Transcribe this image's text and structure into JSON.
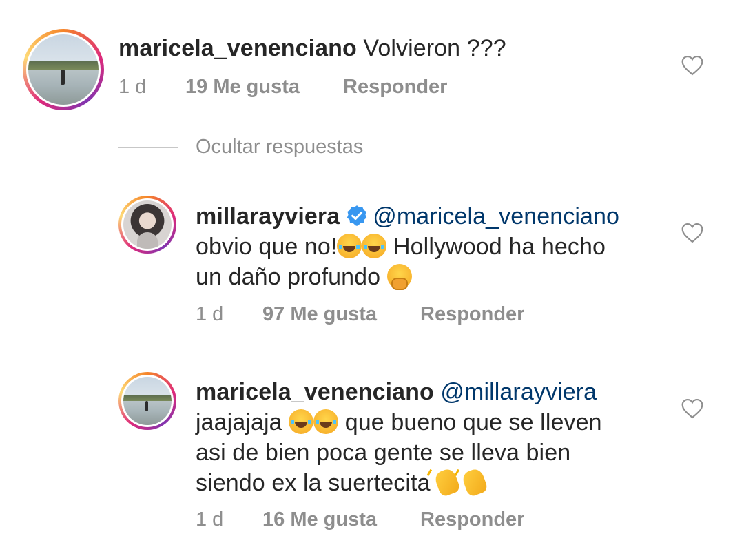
{
  "comments": [
    {
      "username": "maricela_venenciano",
      "verified": false,
      "mention": "",
      "lines": [
        "Volvieron ???"
      ],
      "time": "1 d",
      "likes": "19 Me gusta",
      "reply": "Responder",
      "avatar": "beach-photo"
    },
    {
      "username": "millarayviera",
      "verified": true,
      "mention": "@maricela_venenciano",
      "line1": "obvio que no!",
      "line1_rest": " Hollywood ha hecho",
      "line2": "un daño profundo ",
      "time": "1 d",
      "likes": "97 Me gusta",
      "reply": "Responder",
      "avatar": "portrait-photo",
      "emojis": [
        "face-with-tears-of-joy",
        "face-with-tears-of-joy",
        "face-with-hand-over-mouth"
      ]
    },
    {
      "username": "maricela_venenciano",
      "verified": false,
      "mention": "@millarayviera",
      "line1": "jaajajaja ",
      "line1_rest": " que bueno que se lleven",
      "line2": "asi de bien poca gente se lleva bien",
      "line3": "siendo ex la suertecita ",
      "time": "1 d",
      "likes": "16 Me gusta",
      "reply": "Responder",
      "avatar": "beach-photo",
      "emojis": [
        "face-with-tears-of-joy",
        "face-with-tears-of-joy",
        "clapping-hands",
        "clapping-hands"
      ]
    }
  ],
  "replies_toggle": "Ocultar respuestas",
  "icons": {
    "like": "heart-outline-icon",
    "verified": "verified-badge-icon"
  },
  "colors": {
    "username": "#262626",
    "mention": "#00376b",
    "meta": "#8e8e8e",
    "verified": "#3897f0"
  }
}
